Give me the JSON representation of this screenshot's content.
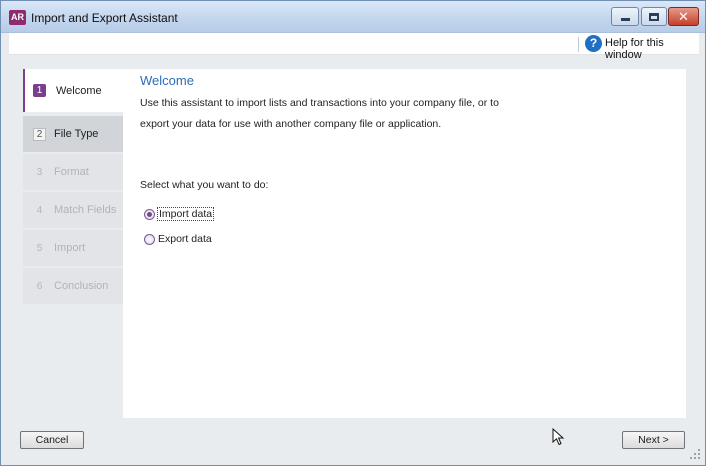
{
  "window": {
    "logo_text": "AR",
    "title": "Import and Export Assistant"
  },
  "help": {
    "label": "Help for this window",
    "icon_glyph": "?"
  },
  "steps": [
    {
      "num": "1",
      "label": "Welcome",
      "state": "active"
    },
    {
      "num": "2",
      "label": "File Type",
      "state": "next"
    },
    {
      "num": "3",
      "label": "Format",
      "state": "disabled"
    },
    {
      "num": "4",
      "label": "Match Fields",
      "state": "disabled"
    },
    {
      "num": "5",
      "label": "Import",
      "state": "disabled"
    },
    {
      "num": "6",
      "label": "Conclusion",
      "state": "disabled"
    }
  ],
  "content": {
    "heading": "Welcome",
    "intro": "Use this assistant to import lists and transactions into your company file, or to export your data for use with another company file or application.",
    "prompt": "Select what you want to do:",
    "options": [
      {
        "label": "Import data",
        "selected": true
      },
      {
        "label": "Export data",
        "selected": false
      }
    ]
  },
  "footer": {
    "cancel_label": "Cancel",
    "next_label": "Next >"
  },
  "colors": {
    "accent": "#7a3e8e",
    "heading": "#2a6db8",
    "help_icon": "#1f6fc5",
    "close_button": "#c4402a"
  }
}
